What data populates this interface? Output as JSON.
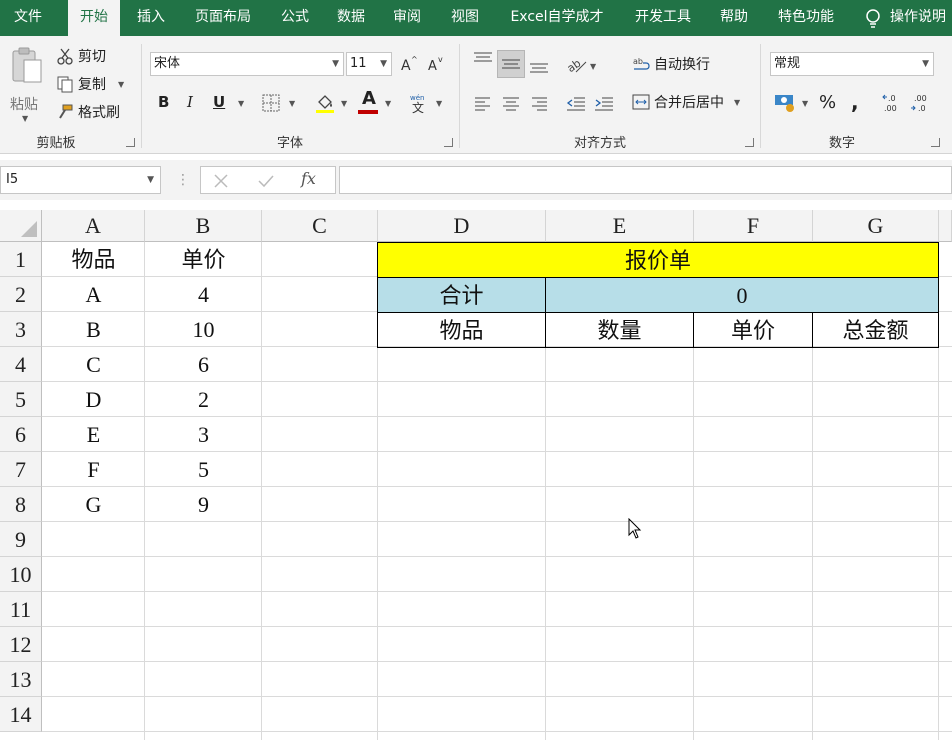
{
  "tabs": [
    "文件",
    "开始",
    "插入",
    "页面布局",
    "公式",
    "数据",
    "审阅",
    "视图",
    "Excel自学成才",
    "开发工具",
    "帮助",
    "特色功能",
    "操作说明"
  ],
  "ribbon": {
    "clipboard": {
      "paste": "粘贴",
      "cut": "剪切",
      "copy": "复制",
      "format_painter": "格式刷",
      "label": "剪贴板"
    },
    "font": {
      "name": "宋体",
      "size": "11",
      "bold": "B",
      "italic": "I",
      "underline": "U",
      "font_color_glyph": "A",
      "label": "字体"
    },
    "alignment": {
      "wrap": "自动换行",
      "merge": "合并后居中",
      "label": "对齐方式"
    },
    "number": {
      "format": "常规",
      "percent": "%",
      "comma": ",",
      "label": "数字"
    }
  },
  "formula_bar": {
    "name_box": "I5",
    "formula": "",
    "fx": "fx"
  },
  "columns": [
    "A",
    "B",
    "C",
    "D",
    "E",
    "F",
    "G"
  ],
  "rows": [
    "1",
    "2",
    "3",
    "4",
    "5",
    "6",
    "7",
    "8",
    "9",
    "10",
    "11",
    "12",
    "13",
    "14"
  ],
  "cells": {
    "A": [
      "物品",
      "A",
      "B",
      "C",
      "D",
      "E",
      "F",
      "G"
    ],
    "B": [
      "单价",
      "4",
      "10",
      "6",
      "2",
      "3",
      "5",
      "9"
    ]
  },
  "quote": {
    "title": "报价单",
    "total_label": "合计",
    "total_value": "0",
    "headers": [
      "物品",
      "数量",
      "单价",
      "总金额"
    ]
  },
  "colors": {
    "accent": "#217346",
    "title_fill": "#ffff00",
    "total_fill": "#b7dee8"
  }
}
